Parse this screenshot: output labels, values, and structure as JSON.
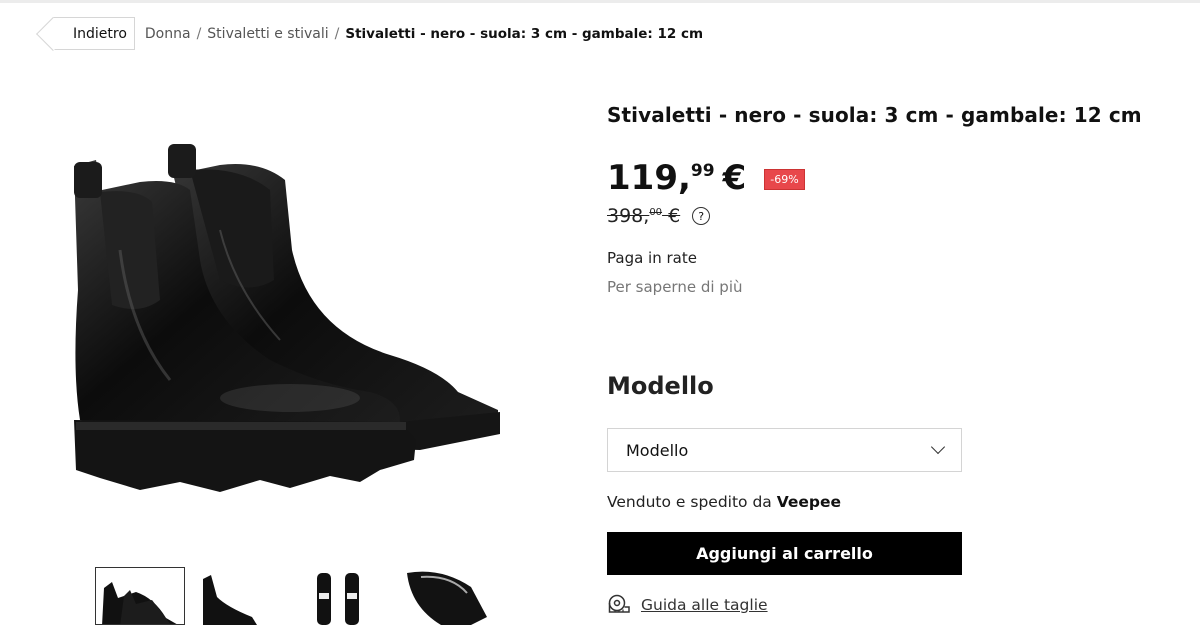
{
  "breadcrumb": {
    "back_label": "Indietro",
    "items": [
      "Donna",
      "Stivaletti e stivali"
    ],
    "separator": "/",
    "current": "Stivaletti - nero - suola: 3 cm - gambale: 12 cm"
  },
  "product": {
    "title": "Stivaletti - nero - suola: 3 cm - gambale: 12 cm",
    "price_int": "119,",
    "price_dec": "99",
    "currency": "€",
    "discount": "-69%",
    "old_price_int": "398,",
    "old_price_dec": "00",
    "old_currency": "€",
    "help_symbol": "?",
    "installments": "Paga in rate",
    "learn_more": "Per saperne di più",
    "variant_heading": "Modello",
    "variant_select_value": "Modello",
    "seller_prefix": "Venduto e spedito da",
    "seller_name": "Veepee",
    "add_to_cart": "Aggiungi al carrello",
    "size_guide": "Guida alle taglie"
  },
  "gallery": {
    "thumbnail_count": 4,
    "active_index": 0
  },
  "colors": {
    "discount_badge": "#e8474b",
    "cta_background": "#000000",
    "cta_text": "#ffffff"
  },
  "icons": [
    "help-icon",
    "chevron-down-icon",
    "measuring-tape-icon"
  ]
}
